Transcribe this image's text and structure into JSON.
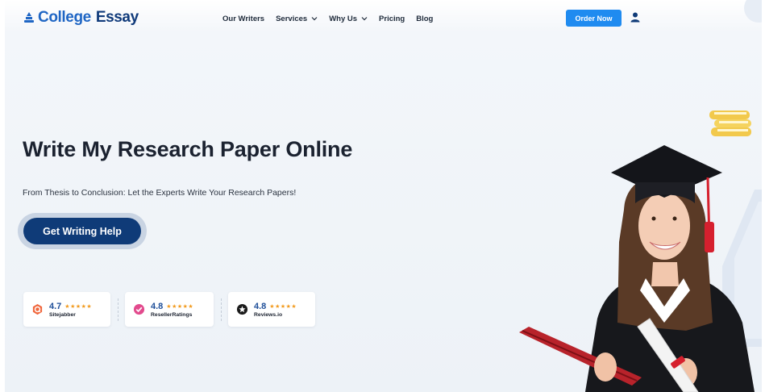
{
  "header": {
    "logo_first": "College",
    "logo_second": "Essay",
    "nav": [
      {
        "label": "Our Writers",
        "has_dropdown": false
      },
      {
        "label": "Services",
        "has_dropdown": true
      },
      {
        "label": "Why Us",
        "has_dropdown": true
      },
      {
        "label": "Pricing",
        "has_dropdown": false
      },
      {
        "label": "Blog",
        "has_dropdown": false
      }
    ],
    "order_label": "Order Now"
  },
  "hero": {
    "title": "Write My Research Paper Online",
    "subtitle": "From Thesis to Conclusion: Let the Experts Write Your Research Papers!",
    "cta_label": "Get Writing Help"
  },
  "ratings": [
    {
      "score": "4.7",
      "name": "Sitejabber",
      "stars": "★★★★★",
      "icon": "sitejabber-icon",
      "color": "#f0663c"
    },
    {
      "score": "4.8",
      "name": "ResellerRatings",
      "stars": "★★★★★",
      "icon": "resellerratings-icon",
      "color": "#e24a8d"
    },
    {
      "score": "4.8",
      "name": "Reviews.io",
      "stars": "★★★★★",
      "icon": "reviews-io-icon",
      "color": "#1b1b1b"
    }
  ],
  "colors": {
    "brand_blue": "#1f66c4",
    "brand_navy": "#0f3a7a",
    "order_button": "#1f8bf0",
    "cta_button": "#0f3b78",
    "star": "#f29b1f"
  }
}
